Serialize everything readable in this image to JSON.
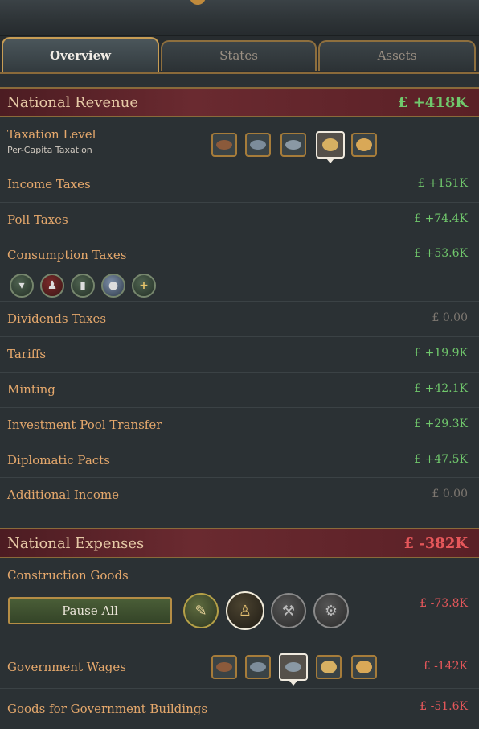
{
  "tabs": [
    {
      "label": "Overview"
    },
    {
      "label": "States"
    },
    {
      "label": "Assets"
    }
  ],
  "revenue": {
    "title": "National Revenue",
    "amount": "£ +418K",
    "taxation": {
      "label": "Taxation Level",
      "sublabel": "Per-Capita Taxation"
    },
    "rows": {
      "income": {
        "label": "Income Taxes",
        "value": "£ +151K"
      },
      "poll": {
        "label": "Poll Taxes",
        "value": "£ +74.4K"
      },
      "consumption": {
        "label": "Consumption Taxes",
        "value": "£ +53.6K"
      },
      "dividends": {
        "label": "Dividends Taxes",
        "value": "£ 0.00"
      },
      "tariffs": {
        "label": "Tariffs",
        "value": "£ +19.9K"
      },
      "minting": {
        "label": "Minting",
        "value": "£ +42.1K"
      },
      "investment": {
        "label": "Investment Pool Transfer",
        "value": "£ +29.3K"
      },
      "diplomatic": {
        "label": "Diplomatic Pacts",
        "value": "£ +47.5K"
      },
      "additional": {
        "label": "Additional Income",
        "value": "£ 0.00"
      }
    },
    "consumption_add_icon": "+"
  },
  "expenses": {
    "title": "National Expenses",
    "amount": "£ -382K",
    "construction": {
      "label": "Construction Goods",
      "value": "£ -73.8K",
      "pause_label": "Pause All"
    },
    "wages": {
      "label": "Government Wages",
      "value": "£ -142K"
    },
    "goods_buildings": {
      "label": "Goods for Government Buildings",
      "value": "£ -51.6K"
    }
  },
  "colors": {
    "positive": "#70c86c",
    "negative": "#e5575a",
    "neutral": "#7d7770",
    "label": "#e5a86c",
    "header_bg": "#5a2026",
    "gold_border": "#a67c3a"
  },
  "icons": {
    "tax_levels": [
      "very-low-tax-icon",
      "low-tax-icon",
      "medium-tax-icon",
      "high-tax-icon",
      "very-high-tax-icon"
    ],
    "consumption": [
      "grain-icon",
      "clothes-icon",
      "liquor-icon",
      "porcelain-icon",
      "add-icon"
    ],
    "construction": [
      "tools-icon",
      "selected-construction-icon",
      "iron-icon",
      "steel-icon"
    ],
    "wages": [
      "very-low-wage-icon",
      "low-wage-icon",
      "medium-wage-icon",
      "high-wage-icon",
      "very-high-wage-icon"
    ]
  }
}
